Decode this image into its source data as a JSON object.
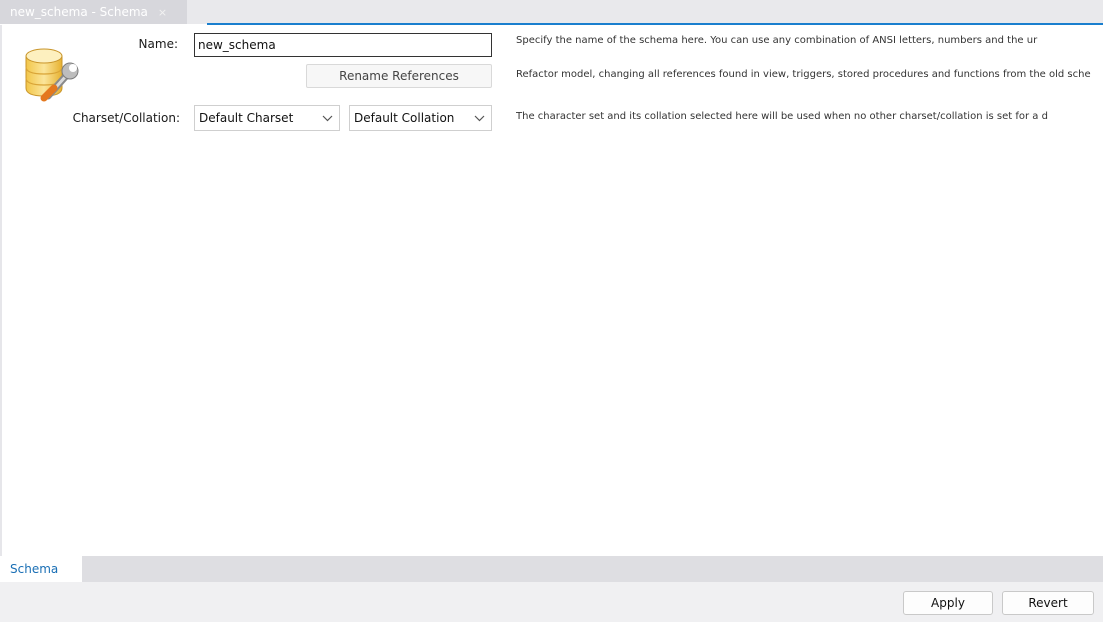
{
  "tabs": {
    "document_tab": "new_schema - Schema",
    "close_glyph": "×",
    "subtab": "Schema"
  },
  "form": {
    "name_label": "Name:",
    "name_value": "new_schema",
    "rename_button": "Rename References",
    "charset_label": "Charset/Collation:",
    "charset_value": "Default Charset",
    "collation_value": "Default Collation"
  },
  "hints": {
    "name": "Specify the name of the schema here. You can use any combination of ANSI letters, numbers and the ur",
    "rename": "Refactor model, changing all references found in view, triggers, stored procedures and functions from the old sche",
    "charset": "The character set and its collation selected here will be used when no other charset/collation is set for a d"
  },
  "footer": {
    "apply": "Apply",
    "revert": "Revert"
  },
  "icons": {
    "schema": "database-wrench-icon",
    "dropdown": "chevron-down-icon"
  },
  "colors": {
    "accent": "#1a7fce",
    "subtab_text": "#1a6fb5"
  }
}
